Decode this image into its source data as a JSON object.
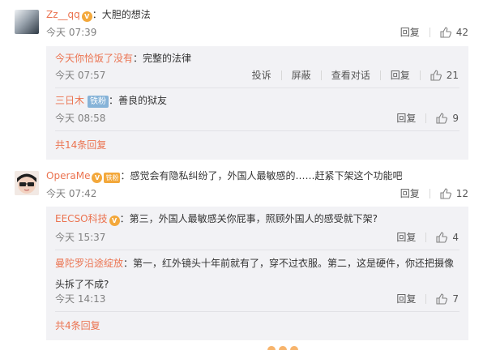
{
  "comments": [
    {
      "user": "Zz__qq",
      "badge": "V",
      "text": "：大胆的想法",
      "time": "今天 07:39",
      "reply_label": "回复",
      "likes": "42",
      "replies": [
        {
          "user": "今天你恰饭了没有",
          "text": "：完整的法律",
          "time": "今天 07:57",
          "actions": [
            "投诉",
            "屏蔽",
            "查看对话",
            "回复"
          ],
          "likes": "21"
        },
        {
          "user": "三日木",
          "tag": "铁粉",
          "text": "：善良的狱友",
          "time": "今天 08:58",
          "reply_label": "回复",
          "likes": "9"
        }
      ],
      "more_label": "共14条回复"
    },
    {
      "user": "OperaMe",
      "badge": "V",
      "badge2": "铁粉",
      "text": "：感觉会有隐私纠纷了，外国人最敏感的……赶紧下架这个功能吧",
      "time": "今天 07:42",
      "reply_label": "回复",
      "likes": "12",
      "replies": [
        {
          "user": "EECSO科技",
          "badge": "V",
          "text": "：第三，外国人最敏感关你屁事，照顾外国人的感受就下架?",
          "time": "今天 15:37",
          "reply_label": "回复",
          "likes": "4"
        },
        {
          "user": "曼陀罗沿途绽放",
          "text": "：第一，红外镜头十年前就有了，穿不过衣服。第二，这是硬件，你还把摄像",
          "text2": "头拆了不成?",
          "time": "今天 14:13",
          "reply_label": "回复",
          "likes": "7"
        }
      ],
      "more_label": "共4条回复"
    }
  ],
  "colors": {
    "username": "#eb7350",
    "reply_bg": "#f2f2f5",
    "badge": "#f3a83b",
    "tag": "#86b3d8"
  },
  "icons": {
    "like": "thumbs-up-icon"
  }
}
